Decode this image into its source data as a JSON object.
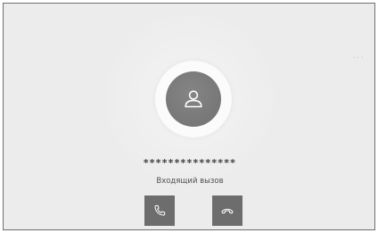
{
  "call": {
    "number": "***************",
    "status": "Входящий вызов"
  },
  "menu": {
    "more_label": "···"
  },
  "buttons": {
    "answer_icon": "phone-icon",
    "decline_icon": "hang-up-icon"
  },
  "colors": {
    "background": "#ececec",
    "avatar": "#7a7a7a",
    "button": "#6d6d6d"
  }
}
